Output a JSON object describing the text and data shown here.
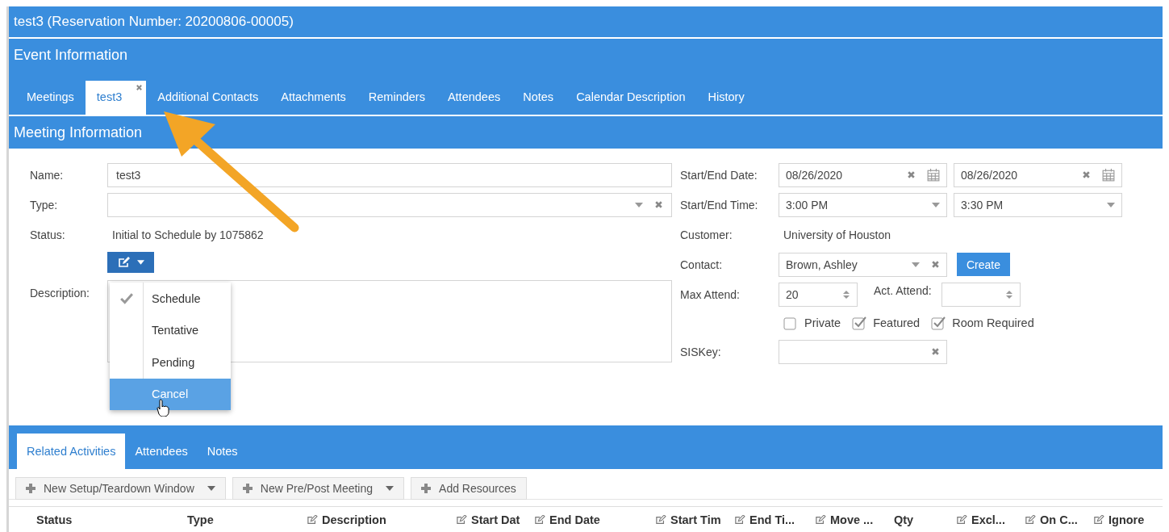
{
  "window": {
    "title": "test3 (Reservation Number: 20200806-00005)"
  },
  "event_section": {
    "title": "Event Information"
  },
  "tabs": [
    {
      "label": "Meetings",
      "selected": false,
      "closable": false
    },
    {
      "label": "test3",
      "selected": true,
      "closable": true
    },
    {
      "label": "Additional Contacts",
      "selected": false,
      "closable": false
    },
    {
      "label": "Attachments",
      "selected": false,
      "closable": false
    },
    {
      "label": "Reminders",
      "selected": false,
      "closable": false
    },
    {
      "label": "Attendees",
      "selected": false,
      "closable": false
    },
    {
      "label": "Notes",
      "selected": false,
      "closable": false
    },
    {
      "label": "Calendar Description",
      "selected": false,
      "closable": false
    },
    {
      "label": "History",
      "selected": false,
      "closable": false
    }
  ],
  "meeting_section": {
    "title": "Meeting Information"
  },
  "form": {
    "name": {
      "label": "Name:",
      "value": "test3"
    },
    "type": {
      "label": "Type:"
    },
    "status": {
      "label": "Status:",
      "value": "Initial to Schedule by 1075862"
    },
    "status_menu": [
      {
        "label": "Schedule",
        "selected": true,
        "hovered": false
      },
      {
        "label": "Tentative",
        "selected": false,
        "hovered": false
      },
      {
        "label": "Pending",
        "selected": false,
        "hovered": false
      },
      {
        "label": "Cancel",
        "selected": false,
        "hovered": true
      }
    ],
    "description": {
      "label": "Description:"
    },
    "dates": {
      "label": "Start/End Date:",
      "start": "08/26/2020",
      "end": "08/26/2020"
    },
    "times": {
      "label": "Start/End Time:",
      "start": "3:00 PM",
      "end": "3:30 PM"
    },
    "customer": {
      "label": "Customer:",
      "value": "University of Houston"
    },
    "contact": {
      "label": "Contact:",
      "value": "Brown, Ashley",
      "button": "Create"
    },
    "max_attend": {
      "label": "Max Attend:",
      "value": "20"
    },
    "act_attend": {
      "label": "Act. Attend:"
    },
    "checkboxes": [
      {
        "label": "Private",
        "checked": false
      },
      {
        "label": "Featured",
        "checked": true
      },
      {
        "label": "Room Required",
        "checked": true
      }
    ],
    "siskey": {
      "label": "SISKey:"
    }
  },
  "bottom_tabs": [
    {
      "label": "Related Activities",
      "selected": true
    },
    {
      "label": "Attendees",
      "selected": false
    },
    {
      "label": "Notes",
      "selected": false
    }
  ],
  "toolbar": [
    {
      "label": "New Setup/Teardown Window",
      "has_caret": true
    },
    {
      "label": "New Pre/Post Meeting",
      "has_caret": true
    },
    {
      "label": "Add Resources",
      "has_caret": false
    }
  ],
  "table": {
    "columns": [
      {
        "label": "Status",
        "editable": false
      },
      {
        "label": "Type",
        "editable": false
      },
      {
        "label": "Description",
        "editable": true
      },
      {
        "label": "Start Dat",
        "editable": true
      },
      {
        "label": "End Date",
        "editable": true
      },
      {
        "label": "Start Tim",
        "editable": true
      },
      {
        "label": "End Ti...",
        "editable": true
      },
      {
        "label": "Move ...",
        "editable": true
      },
      {
        "label": "Qty",
        "editable": false
      },
      {
        "label": "Excl...",
        "editable": true
      },
      {
        "label": "On C...",
        "editable": true
      },
      {
        "label": "Ignore",
        "editable": true
      }
    ]
  }
}
